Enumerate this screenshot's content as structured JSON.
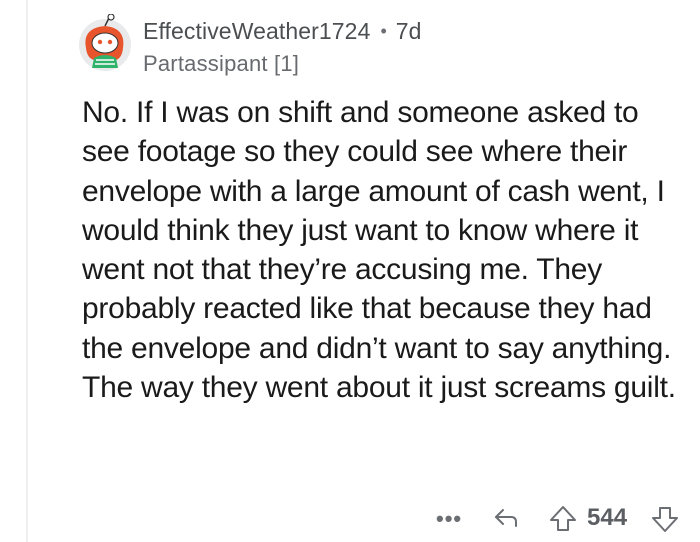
{
  "comment": {
    "username": "EffectiveWeather1724",
    "separator": "•",
    "age": "7d",
    "flair": "Partassipant [1]",
    "body": "No. If I was on shift and someone asked to see footage so they could see where their envelope with a large amount of cash went, I would think they just want to know where it went not that they’re accusing me. They probably reacted like that because they had the envelope and didn’t want to say anything. The way they went about it just screams guilt."
  },
  "actions": {
    "more_label": "•••",
    "reply_icon": "reply-arrow-icon",
    "upvote_icon": "upvote-arrow-icon",
    "score": "544",
    "downvote_icon": "downvote-arrow-icon"
  },
  "colors": {
    "text": "#1a1a1b",
    "meta": "#4c4f52",
    "icon": "#6b6e72"
  }
}
